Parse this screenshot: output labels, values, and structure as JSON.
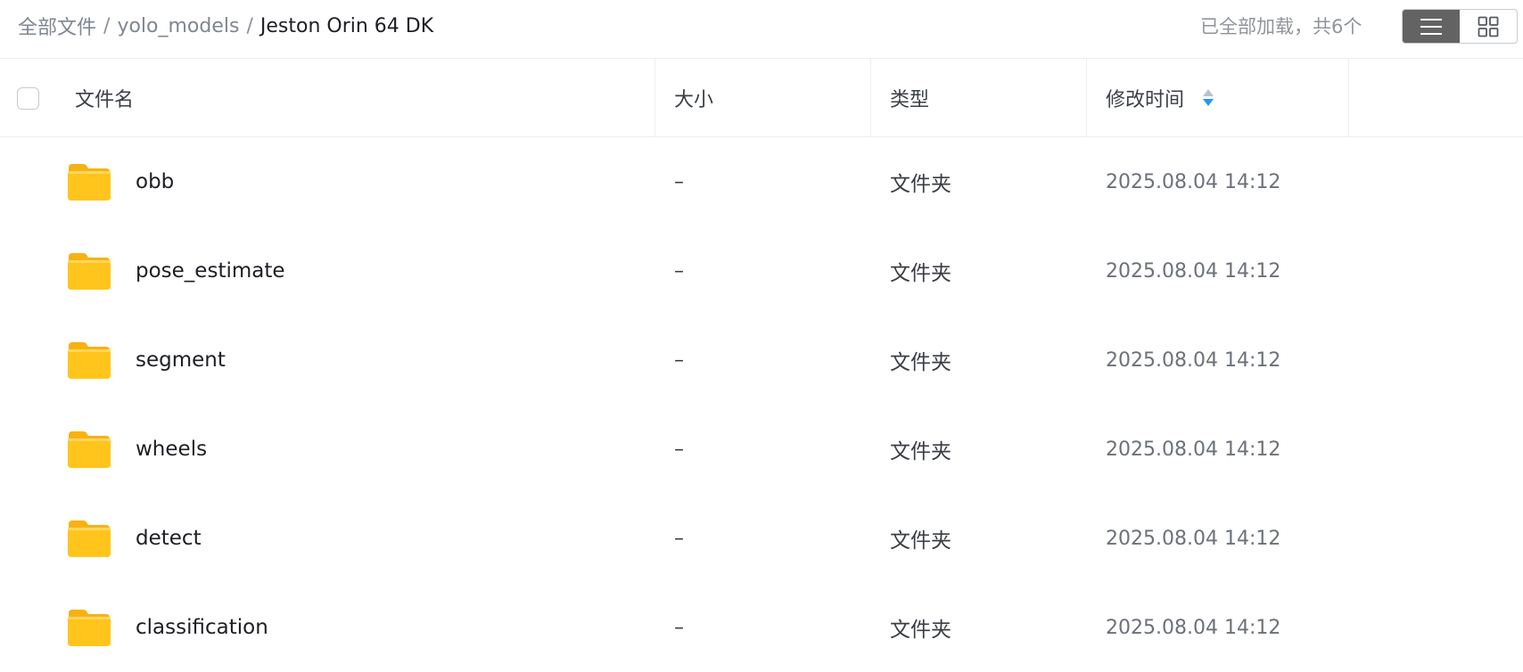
{
  "breadcrumb": {
    "root": "全部文件",
    "separator": "/",
    "parent": "yolo_models",
    "current": "Jeston Orin 64 DK"
  },
  "status": {
    "loaded_text": "已全部加载，共6个"
  },
  "view_toggle": {
    "list_icon": "list-view-icon",
    "grid_icon": "grid-view-icon",
    "active": "list"
  },
  "table": {
    "columns": {
      "name": "文件名",
      "size": "大小",
      "type": "类型",
      "modified": "修改时间"
    },
    "sort": {
      "column": "modified",
      "direction": "descending",
      "icon": "sort-icon"
    },
    "rows": [
      {
        "name": "obb",
        "size": "–",
        "type": "文件夹",
        "modified": "2025.08.04 14:12",
        "icon": "folder-icon"
      },
      {
        "name": "pose_estimate",
        "size": "–",
        "type": "文件夹",
        "modified": "2025.08.04 14:12",
        "icon": "folder-icon"
      },
      {
        "name": "segment",
        "size": "–",
        "type": "文件夹",
        "modified": "2025.08.04 14:12",
        "icon": "folder-icon"
      },
      {
        "name": "wheels",
        "size": "–",
        "type": "文件夹",
        "modified": "2025.08.04 14:12",
        "icon": "folder-icon"
      },
      {
        "name": "detect",
        "size": "–",
        "type": "文件夹",
        "modified": "2025.08.04 14:12",
        "icon": "folder-icon"
      },
      {
        "name": "classification",
        "size": "–",
        "type": "文件夹",
        "modified": "2025.08.04 14:12",
        "icon": "folder-icon"
      }
    ]
  },
  "colors": {
    "folder": "#ffc51c",
    "folder_back": "#f7b212",
    "sort_active": "#1f9bf0",
    "toggle_active": "#636363"
  }
}
